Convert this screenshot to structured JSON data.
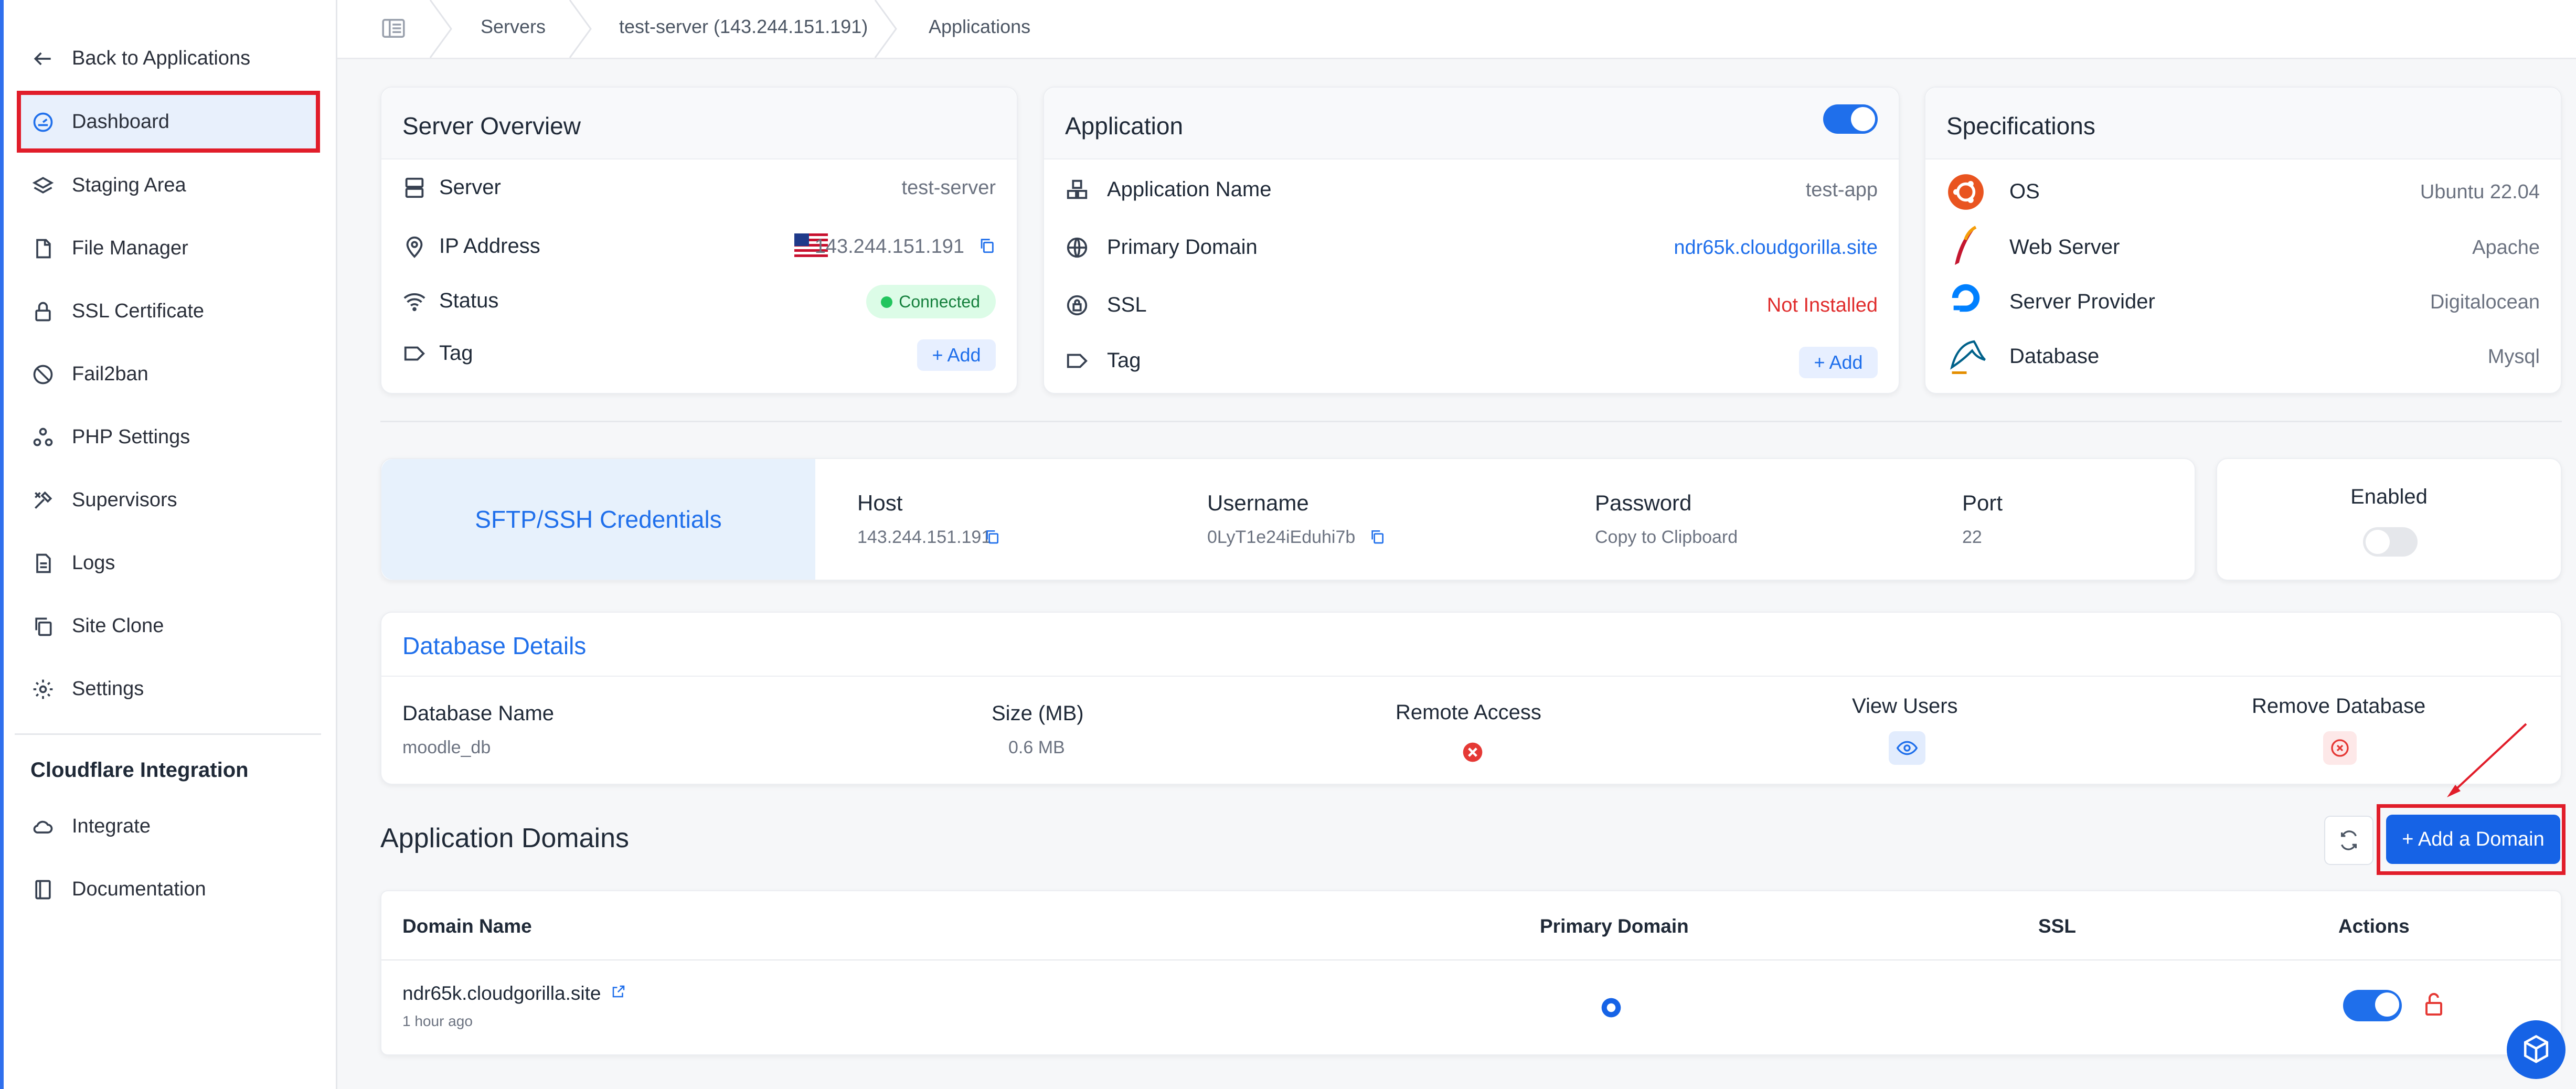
{
  "sidebar": {
    "back_label": "Back to Applications",
    "items": [
      {
        "label": "Dashboard",
        "icon": "dashboard-icon"
      },
      {
        "label": "Staging Area",
        "icon": "layers-icon"
      },
      {
        "label": "File Manager",
        "icon": "file-icon"
      },
      {
        "label": "SSL Certificate",
        "icon": "lock-icon"
      },
      {
        "label": "Fail2ban",
        "icon": "ban-icon"
      },
      {
        "label": "PHP Settings",
        "icon": "nodes-icon"
      },
      {
        "label": "Supervisors",
        "icon": "tools-icon"
      },
      {
        "label": "Logs",
        "icon": "log-icon"
      },
      {
        "label": "Site Clone",
        "icon": "copy-icon"
      },
      {
        "label": "Settings",
        "icon": "gear-icon"
      }
    ],
    "cloudflare_heading": "Cloudflare Integration",
    "integrate_label": "Integrate",
    "documentation_label": "Documentation"
  },
  "breadcrumb": {
    "items": [
      "Servers",
      "test-server (143.244.151.191)",
      "Applications"
    ]
  },
  "server_overview": {
    "title": "Server Overview",
    "server_label": "Server",
    "server_value": "test-server",
    "ip_label": "IP Address",
    "ip_value": "143.244.151.191",
    "status_label": "Status",
    "status_value": "Connected",
    "tag_label": "Tag",
    "add_label": "+ Add"
  },
  "application": {
    "title": "Application",
    "enabled": true,
    "name_label": "Application Name",
    "name_value": "test-app",
    "domain_label": "Primary Domain",
    "domain_value": "ndr65k.cloudgorilla.site",
    "ssl_label": "SSL",
    "ssl_value": "Not Installed",
    "tag_label": "Tag",
    "add_label": "+ Add"
  },
  "specifications": {
    "title": "Specifications",
    "os_label": "OS",
    "os_value": "Ubuntu 22.04",
    "webserver_label": "Web Server",
    "webserver_value": "Apache",
    "provider_label": "Server Provider",
    "provider_value": "Digitalocean",
    "database_label": "Database",
    "database_value": "Mysql"
  },
  "credentials": {
    "title": "SFTP/SSH Credentials",
    "host_label": "Host",
    "host_value": "143.244.151.191",
    "username_label": "Username",
    "username_value": "0LyT1e24iEduhi7b",
    "password_label": "Password",
    "password_value": "Copy to Clipboard",
    "port_label": "Port",
    "port_value": "22",
    "enabled_label": "Enabled",
    "enabled": false
  },
  "database_details": {
    "title": "Database Details",
    "name_label": "Database Name",
    "name_value": "moodle_db",
    "size_label": "Size (MB)",
    "size_value": "0.6 MB",
    "remote_label": "Remote Access",
    "view_users_label": "View Users",
    "remove_label": "Remove Database"
  },
  "domains": {
    "title": "Application Domains",
    "add_button_label": "+ Add a Domain",
    "columns": [
      "Domain Name",
      "Primary Domain",
      "SSL",
      "Actions"
    ],
    "rows": [
      {
        "domain": "ndr65k.cloudgorilla.site",
        "time": "1 hour ago",
        "primary": true,
        "ssl": false,
        "active": true
      }
    ]
  },
  "colors": {
    "accent": "#1663e6",
    "highlight": "#e11d2a",
    "connected": "#22c55e",
    "danger": "#e02d2d"
  }
}
